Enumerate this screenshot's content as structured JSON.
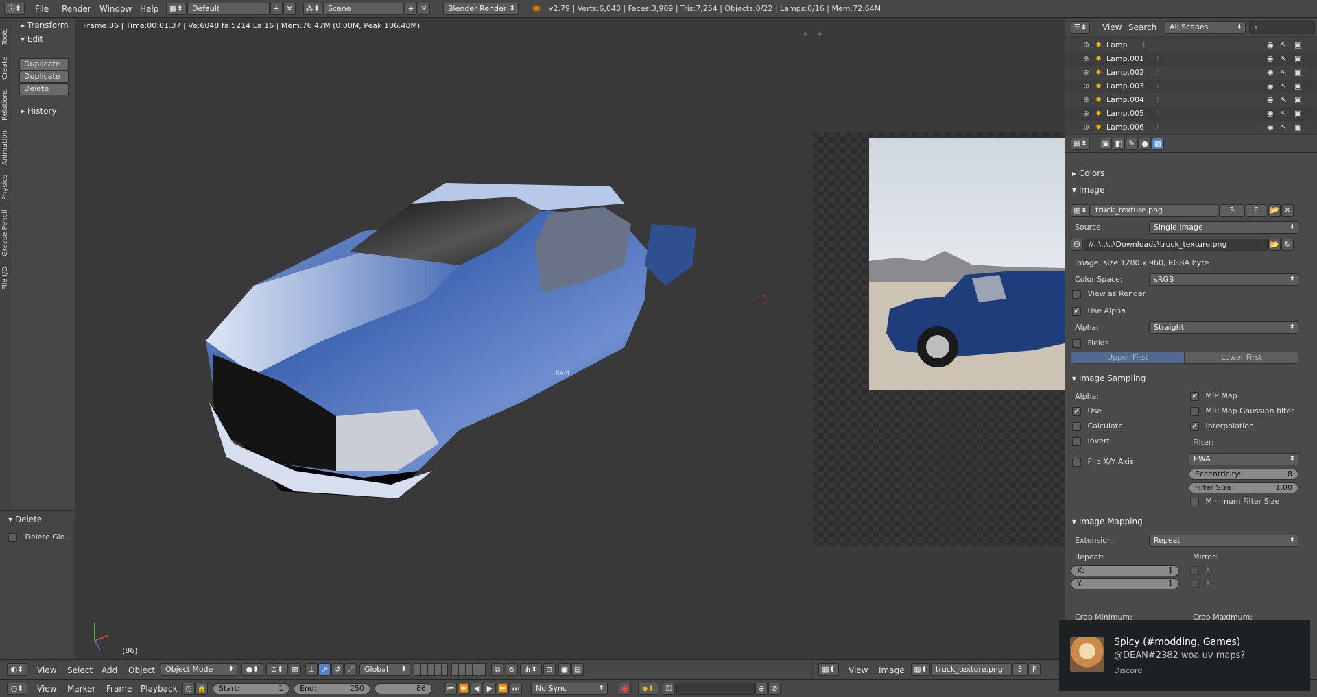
{
  "topbar": {
    "menus": [
      "File",
      "Render",
      "Window",
      "Help"
    ],
    "layout": "Default",
    "scene": "Scene",
    "engine": "Blender Render",
    "stats": "v2.79 | Verts:6,048 | Faces:3,909 | Tris:7,254 | Objects:0/22 | Lamps:0/16 | Mem:72.64M"
  },
  "viewport": {
    "info": "Frame:86 | Time:00:01.37 | Ve:6048 fa:5214 La:16 | Mem:76.47M (0.00M, Peak 106.48M)",
    "frame_label": "(86)",
    "grille_text": "RAM"
  },
  "tool_tabs": [
    "Tools",
    "Create",
    "Relations",
    "Animation",
    "Physics",
    "Grease Pencil",
    "File I/O"
  ],
  "tool_panel": {
    "transform": "Transform",
    "edit": "Edit",
    "buttons": [
      "Duplicate",
      "Duplicate ...",
      "Delete"
    ],
    "history": "History",
    "delete_head": "Delete",
    "delete_global": "Delete Glo..."
  },
  "bottombar": {
    "menus": [
      "View",
      "Select",
      "Add",
      "Object"
    ],
    "mode": "Object Mode",
    "orientation": "Global"
  },
  "timeline": {
    "menus": [
      "View",
      "Marker",
      "Frame",
      "Playback"
    ],
    "start_label": "Start:",
    "start": "1",
    "end_label": "End:",
    "end": "250",
    "current": "86",
    "sync": "No Sync"
  },
  "image_editor": {
    "menus": [
      "View",
      "Image"
    ],
    "image_name": "truck_texture.png",
    "users": "3",
    "fake": "F"
  },
  "outliner": {
    "menus": [
      "View",
      "Search"
    ],
    "filter": "All Scenes",
    "items": [
      "Lamp",
      "Lamp.001",
      "Lamp.002",
      "Lamp.003",
      "Lamp.004",
      "Lamp.005",
      "Lamp.006"
    ]
  },
  "props": {
    "colors": "Colors",
    "image_section": "Image",
    "image_name": "truck_texture.png",
    "users": "3",
    "fake": "F",
    "source_label": "Source:",
    "source": "Single Image",
    "filepath": "//..\\..\\..\\Downloads\\truck_texture.png",
    "image_info": "Image: size 1280 x 960, RGBA byte",
    "colorspace_label": "Color Space:",
    "colorspace": "sRGB",
    "view_as_render": "View as Render",
    "use_alpha": "Use Alpha",
    "alpha_label": "Alpha:",
    "alpha": "Straight",
    "fields": "Fields",
    "upper_first": "Upper First",
    "lower_first": "Lower First",
    "sampling": "Image Sampling",
    "s_alpha": "Alpha:",
    "s_use": "Use",
    "s_calculate": "Calculate",
    "s_invert": "Invert",
    "s_flip": "Flip X/Y Axis",
    "mip_map": "MIP Map",
    "mip_gauss": "MIP Map Gaussian filter",
    "interpolation": "Interpolation",
    "filter_label": "Filter:",
    "filter": "EWA",
    "eccentricity_label": "Eccentricity:",
    "eccentricity": "8",
    "filter_size_label": "Filter Size:",
    "filter_size": "1.00",
    "min_filter": "Minimum Filter Size",
    "mapping": "Image Mapping",
    "extension_label": "Extension:",
    "extension": "Repeat",
    "repeat_label": "Repeat:",
    "mirror_label": "Mirror:",
    "x_label": "X:",
    "x_val": "1",
    "y_label": "Y:",
    "y_val": "1",
    "mx": "X",
    "my": "Y",
    "crop_min": "Crop Minimum:",
    "crop_max": "Crop Maximum:"
  },
  "toast": {
    "title": "Spicy (#modding, Games)",
    "message": "@DEAN#2382 woa uv maps?",
    "app": "Discord"
  },
  "colors": {
    "truck_blue": "#2f4f8f",
    "active_blue": "#5680c2"
  }
}
